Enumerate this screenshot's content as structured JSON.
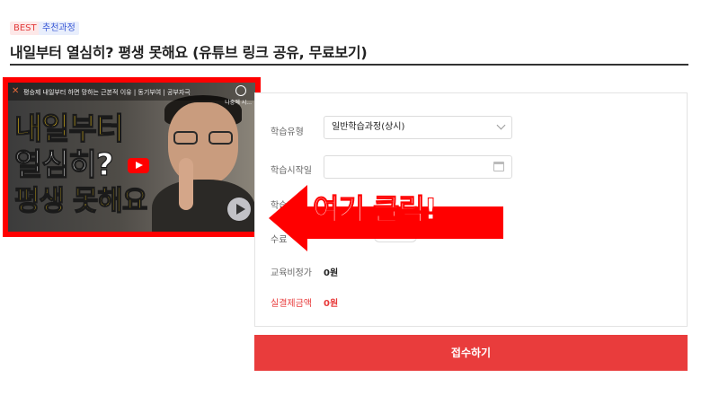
{
  "tags": {
    "best": "BEST",
    "recommended": "추천과정"
  },
  "course": {
    "title": "내일부터 열심히? 평생 못해요 (유튜브 링크 공유, 무료보기)"
  },
  "video": {
    "caption": "평승제 내일부터 하면 망하는 근본적 이유 | 동기부여 | 공부자극",
    "watch_later": "나중에 시...",
    "line1": "내일부터",
    "line2": "열심히?",
    "line3": "평생 못해요",
    "play_icon": "play-icon",
    "youtube_icon": "youtube-icon"
  },
  "form": {
    "type_label": "학습유형",
    "type_value": "일반학습과정(상시)",
    "start_label": "학습시작일",
    "period_label": "학습기간",
    "count_label": "수료",
    "fee_label": "교육비정가",
    "fee_value": "0원",
    "final_label": "실결제금액",
    "final_value": "0원"
  },
  "submit_label": "접수하기",
  "annotation": {
    "text": "여기 클릭!",
    "color": "#ff0000"
  },
  "colors": {
    "accent": "#e93c3c",
    "best_tag": "#e23b3b",
    "recommended_tag": "#3c5bd6"
  }
}
